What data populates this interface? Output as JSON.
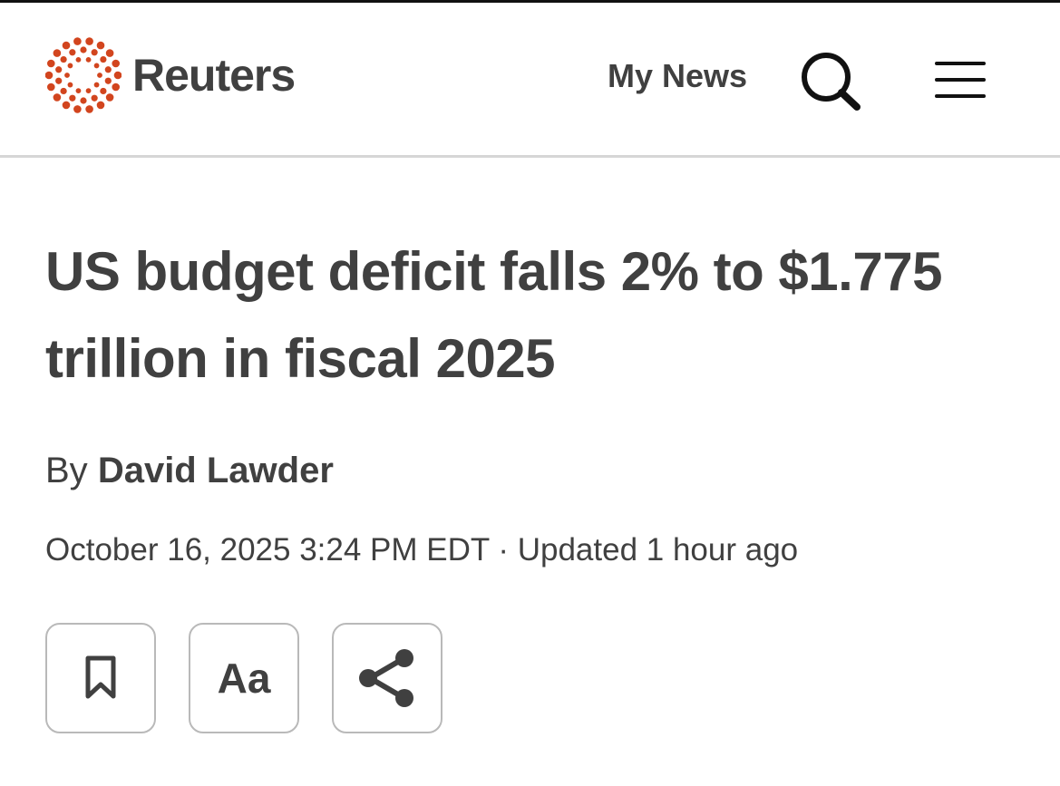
{
  "header": {
    "logo_text": "Reuters",
    "my_news_label": "My News",
    "brand_color": "#d2451e",
    "icons": [
      "reuters-logo-mark",
      "search-icon",
      "hamburger-menu-icon"
    ]
  },
  "article": {
    "headline": "US budget deficit falls 2% to $1.775 trillion in fiscal 2025",
    "byline_prefix": "By",
    "author": "David Lawder",
    "dateline": "October 16, 2025 3:24 PM EDT · Updated 1 hour ago"
  },
  "actions": {
    "text_size_label": "Aa",
    "icons": [
      "bookmark-icon",
      "text-size-icon",
      "share-icon"
    ]
  }
}
